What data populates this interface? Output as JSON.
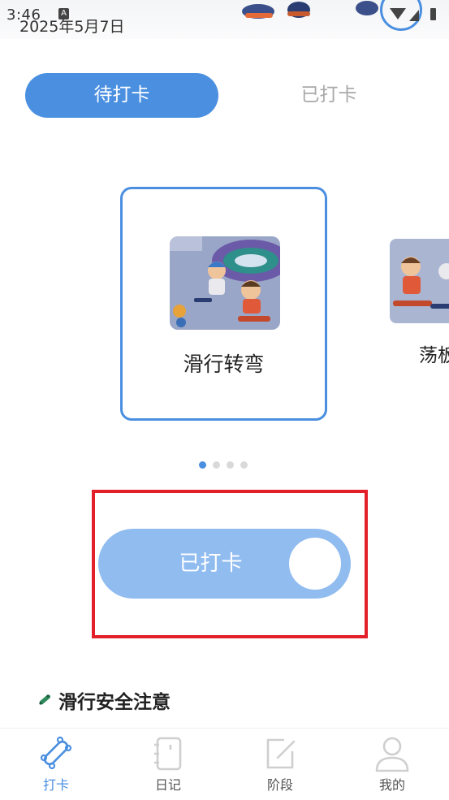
{
  "status_bar": {
    "time": "3:46",
    "indicator": "A"
  },
  "header": {
    "date": "2025年5月7日"
  },
  "tabs": [
    {
      "label": "待打卡",
      "active": true
    },
    {
      "label": "已打卡",
      "active": false
    }
  ],
  "carousel": {
    "cards": [
      {
        "title": "滑行转弯",
        "active": true
      },
      {
        "title": "荡板",
        "active": false
      }
    ],
    "page_count": 4,
    "current_page": 1
  },
  "checkin": {
    "label": "已打卡"
  },
  "section": {
    "title": "滑行安全注意"
  },
  "bottom_nav": [
    {
      "label": "打卡",
      "icon": "skateboard-icon",
      "active": true
    },
    {
      "label": "日记",
      "icon": "notebook-icon",
      "active": false
    },
    {
      "label": "阶段",
      "icon": "edit-square-icon",
      "active": false
    },
    {
      "label": "我的",
      "icon": "user-icon",
      "active": false
    }
  ],
  "colors": {
    "accent": "#4a8fe0",
    "slider": "#91bcf0",
    "highlight": "#e3202a",
    "inactive_text": "#a9a9a9"
  }
}
